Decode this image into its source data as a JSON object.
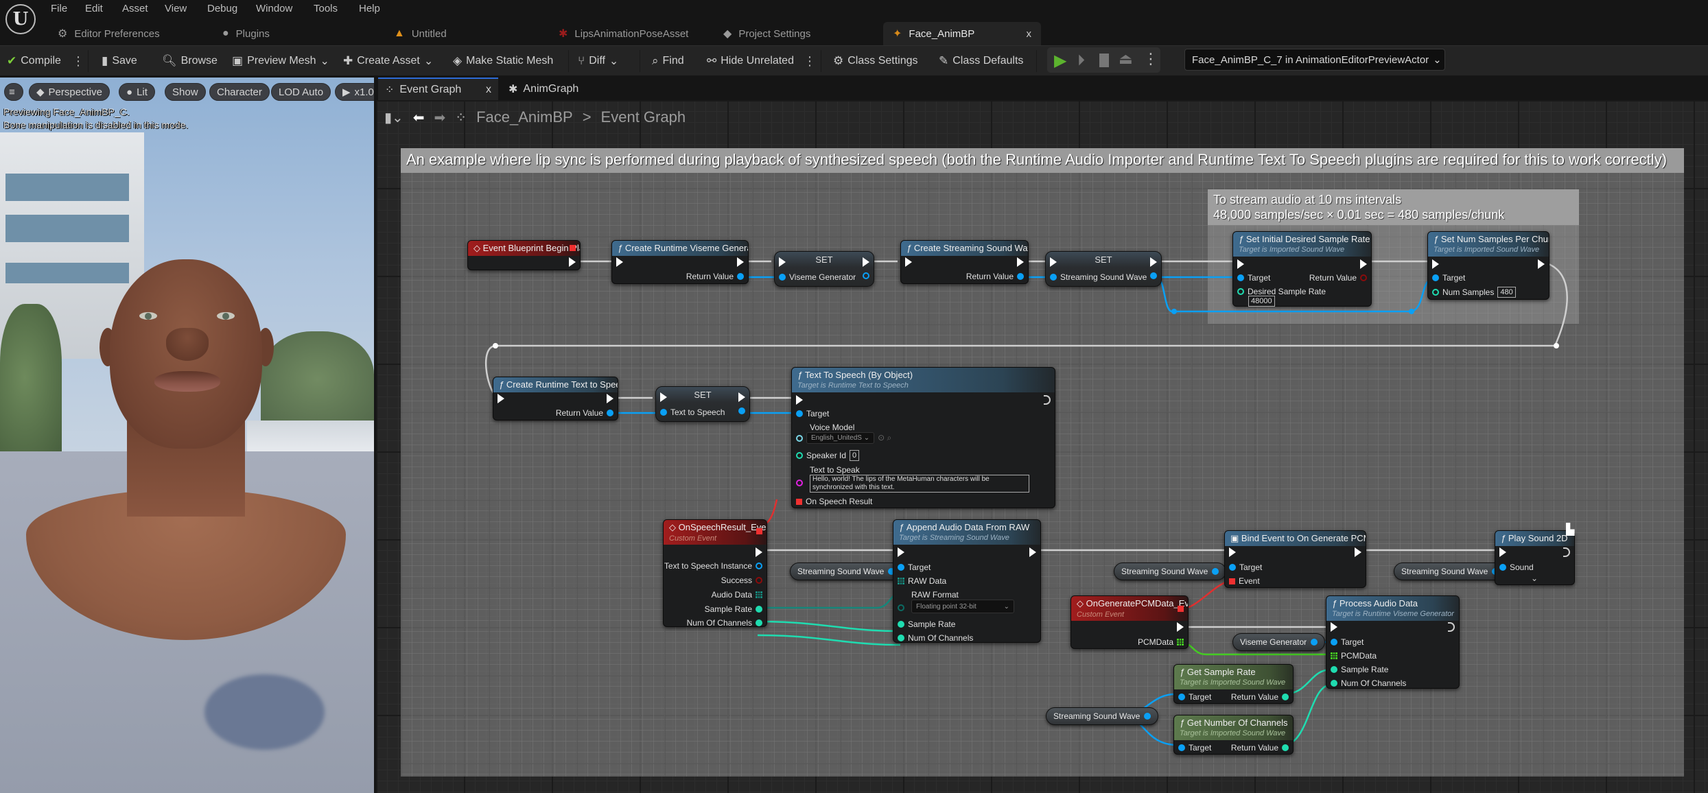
{
  "menu": [
    "File",
    "Edit",
    "Asset",
    "View",
    "Debug",
    "Window",
    "Tools",
    "Help"
  ],
  "doc_tabs": [
    {
      "label": "Editor Preferences",
      "icon": "sliders-icon"
    },
    {
      "label": "Plugins",
      "icon": "plug-icon"
    },
    {
      "label": "Untitled",
      "icon": "level-icon"
    },
    {
      "label": "LipsAnimationPoseAsset",
      "icon": "pose-asset-icon"
    },
    {
      "label": "Project Settings",
      "icon": "settings-icon"
    },
    {
      "label": "Face_AnimBP",
      "icon": "anim-blueprint-icon",
      "close": "x"
    }
  ],
  "toolbar": {
    "compile": "Compile",
    "save": "Save",
    "browse": "Browse",
    "preview_mesh": "Preview Mesh",
    "create_asset": "Create Asset",
    "make_static_mesh": "Make Static Mesh",
    "diff": "Diff",
    "find": "Find",
    "hide_unrelated": "Hide Unrelated",
    "class_settings": "Class Settings",
    "class_defaults": "Class Defaults",
    "debug_object": "Face_AnimBP_C_7 in AnimationEditorPreviewActor"
  },
  "viewport": {
    "buttons": [
      "Perspective",
      "Lit",
      "Show",
      "Character",
      "LOD Auto",
      "x1.0"
    ],
    "message_line1": "Previewing Face_AnimBP_C.",
    "message_line2": "Bone manipulation is disabled in this mode."
  },
  "graph_tabs": [
    {
      "label": "Event Graph",
      "close": "x"
    },
    {
      "label": "AnimGraph"
    }
  ],
  "breadcrumb": {
    "root": "Face_AnimBP",
    "separator": ">",
    "current": "Event Graph"
  },
  "comments": {
    "main": "An example where lip sync is performed during playback of synthesized speech (both the Runtime Audio Importer and Runtime Text To Speech plugins are required for this to work correctly)",
    "stream_line1": "To stream audio at 10 ms intervals",
    "stream_line2": "48,000 samples/sec × 0.01 sec = 480 samples/chunk"
  },
  "nodes": {
    "begin_play": {
      "title": "Event Blueprint Begin Play"
    },
    "create_viseme": {
      "title": "Create Runtime Viseme Generator",
      "return": "Return Value"
    },
    "set_viseme": {
      "title": "SET",
      "pin": "Viseme Generator"
    },
    "create_ssw": {
      "title": "Create Streaming Sound Wave",
      "return": "Return Value"
    },
    "set_ssw": {
      "title": "SET",
      "pin": "Streaming Sound Wave"
    },
    "set_rate": {
      "title": "Set Initial Desired Sample Rate",
      "subtitle": "Target is Imported Sound Wave",
      "target": "Target",
      "return": "Return Value",
      "param": "Desired Sample Rate",
      "value": "48000"
    },
    "set_chunk": {
      "title": "Set Num Samples Per Chunk",
      "subtitle": "Target is Imported Sound Wave",
      "target": "Target",
      "param": "Num Samples",
      "value": "480"
    },
    "create_tts": {
      "title": "Create Runtime Text to Speech",
      "return": "Return Value"
    },
    "set_tts": {
      "title": "SET",
      "pin": "Text to Speech"
    },
    "tts": {
      "title": "Text To Speech (By Object)",
      "subtitle": "Target is Runtime Text to Speech",
      "target": "Target",
      "voice_label": "Voice Model",
      "voice_value": "English_UnitedS",
      "speaker_label": "Speaker Id",
      "speaker_value": "0",
      "text_label": "Text to Speak",
      "text_value": "Hello, world! The lips of the MetaHuman characters will be synchronized with this text.",
      "result": "On Speech Result"
    },
    "on_speech": {
      "title": "OnSpeechResult_Event",
      "subtitle": "Custom Event",
      "pins": [
        "Text to Speech Instance",
        "Success",
        "Audio Data",
        "Sample Rate",
        "Num Of Channels"
      ]
    },
    "append": {
      "title": "Append Audio Data From RAW",
      "subtitle": "Target is Streaming Sound Wave",
      "target": "Target",
      "raw": "RAW Data",
      "format_label": "RAW Format",
      "format_value": "Floating point 32-bit",
      "rate": "Sample Rate",
      "channels": "Num Of Channels"
    },
    "bind": {
      "title": "Bind Event to On Generate PCMData",
      "target": "Target",
      "event": "Event"
    },
    "play": {
      "title": "Play Sound 2D",
      "sound": "Sound"
    },
    "on_pcm": {
      "title": "OnGeneratePCMData_Event",
      "subtitle": "Custom Event",
      "pin": "PCMData"
    },
    "process": {
      "title": "Process Audio Data",
      "subtitle": "Target is Runtime Viseme Generator",
      "target": "Target",
      "pcm": "PCMData",
      "rate": "Sample Rate",
      "channels": "Num Of Channels"
    },
    "get_rate": {
      "title": "Get Sample Rate",
      "subtitle": "Target is Imported Sound Wave",
      "target": "Target",
      "return": "Return Value"
    },
    "get_channels": {
      "title": "Get Number Of Channels",
      "subtitle": "Target is Imported Sound Wave",
      "target": "Target",
      "return": "Return Value"
    },
    "var_ssw": "Streaming Sound Wave",
    "var_viseme": "Viseme Generator"
  },
  "colors": {
    "exec": "#ffffff",
    "object": "#0aa0f5",
    "integer": "#1fdcb0",
    "delegate": "#f03030",
    "byte_array": "#16867a",
    "pcm_array": "#44cc22",
    "event_header": "#a11d1d",
    "function_header": "#3f6b8e",
    "pure_header": "#5d7a4d",
    "play_button": "#5cb32e"
  }
}
